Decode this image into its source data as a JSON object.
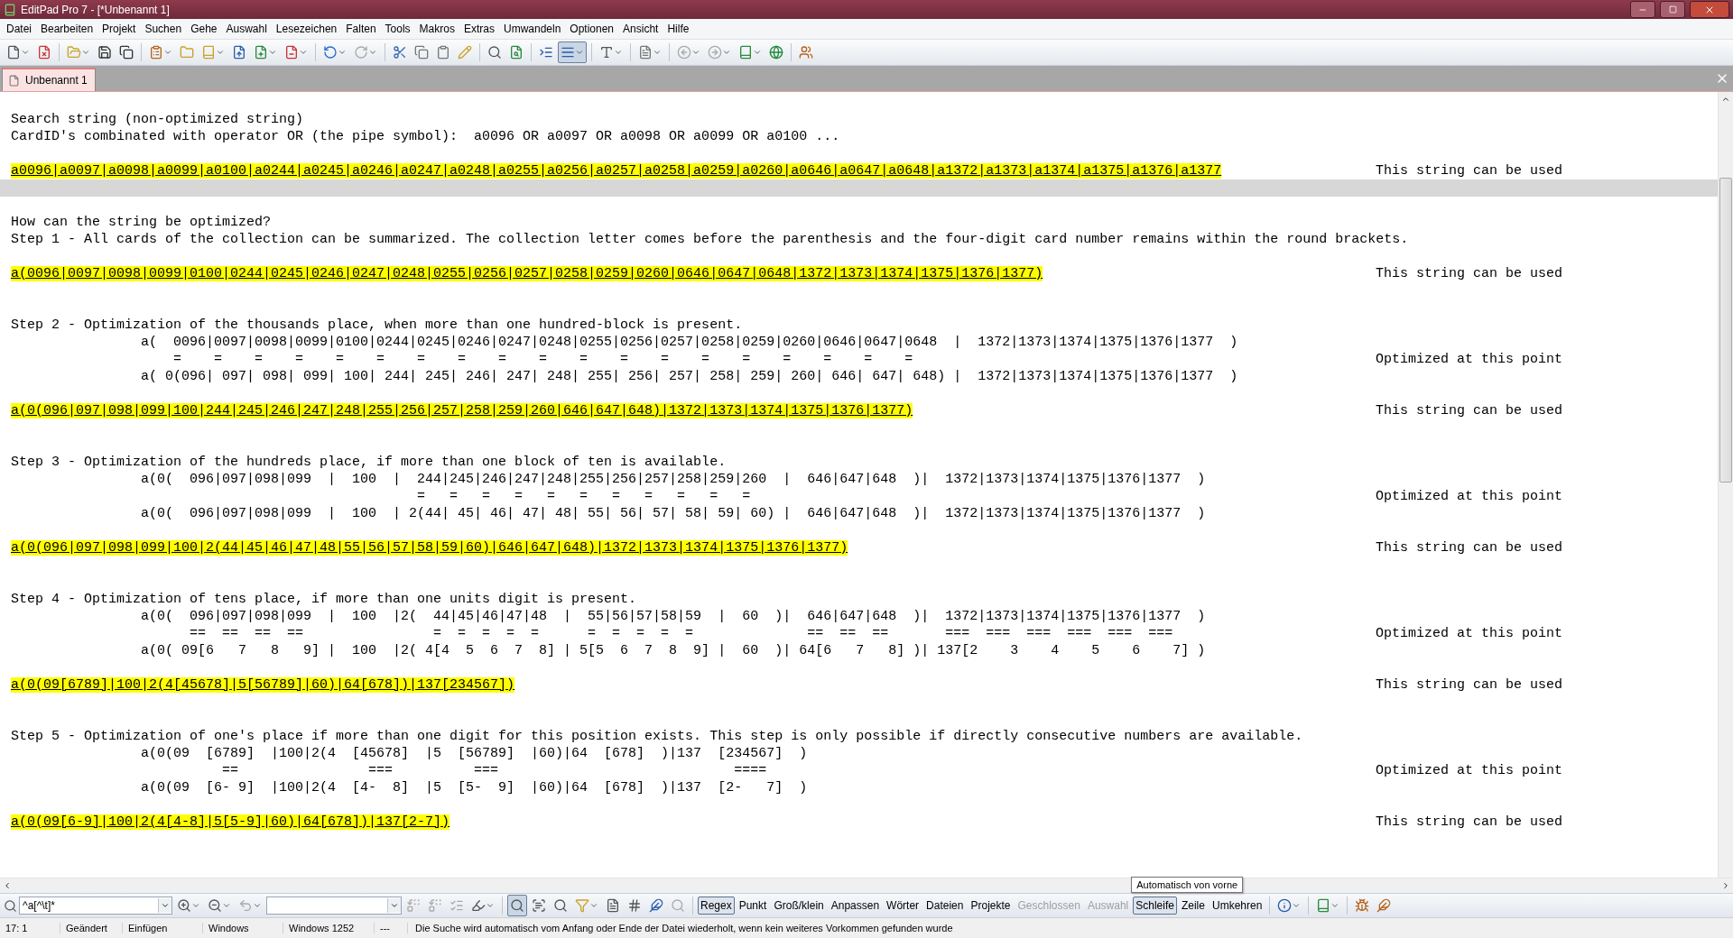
{
  "window": {
    "title": "EditPad Pro 7 - [*Unbenannt 1]"
  },
  "menu": [
    "Datei",
    "Bearbeiten",
    "Projekt",
    "Suchen",
    "Gehe",
    "Auswahl",
    "Lesezeichen",
    "Falten",
    "Tools",
    "Makros",
    "Extras",
    "Umwandeln",
    "Optionen",
    "Ansicht",
    "Hilfe"
  ],
  "tabs": [
    {
      "label": "Unbenannt 1",
      "selected": true
    }
  ],
  "editor": {
    "lines": [
      {
        "kind": "text",
        "current": false,
        "text": "Search string (non-optimized string)"
      },
      {
        "kind": "text",
        "current": false,
        "text": "CardID's combinated with operator OR (the pipe symbol):  a0096 OR a0097 OR a0098 OR a0099 OR a0100 ..."
      },
      {
        "kind": "blank",
        "current": false
      },
      {
        "kind": "match",
        "current": false,
        "text": "a0096|a0097|a0098|a0099|a0100|a0244|a0245|a0246|a0247|a0248|a0255|a0256|a0257|a0258|a0259|a0260|a0646|a0647|a0648|a1372|a1373|a1374|a1375|a1376|a1377",
        "note": "This string can be used"
      },
      {
        "kind": "blank",
        "current": true
      },
      {
        "kind": "blank",
        "current": false
      },
      {
        "kind": "text",
        "current": false,
        "text": "How can the string be optimized?"
      },
      {
        "kind": "text",
        "current": false,
        "text": "Step 1 - All cards of the collection can be summarized. The collection letter comes before the parenthesis and the four-digit card number remains within the round brackets."
      },
      {
        "kind": "blank",
        "current": false
      },
      {
        "kind": "match",
        "current": false,
        "text": "a(0096|0097|0098|0099|0100|0244|0245|0246|0247|0248|0255|0256|0257|0258|0259|0260|0646|0647|0648|1372|1373|1374|1375|1376|1377)",
        "note": "This string can be used"
      },
      {
        "kind": "blank",
        "current": false
      },
      {
        "kind": "blank",
        "current": false
      },
      {
        "kind": "text",
        "current": false,
        "text": "Step 2 - Optimization of the thousands place, when more than one hundred-block is present."
      },
      {
        "kind": "text",
        "current": false,
        "text": "                a(  0096|0097|0098|0099|0100|0244|0245|0246|0247|0248|0255|0256|0257|0258|0259|0260|0646|0647|0648  |  1372|1373|1374|1375|1376|1377  )"
      },
      {
        "kind": "text",
        "current": false,
        "text": "                    =    =    =    =    =    =    =    =    =    =    =    =    =    =    =    =    =    =    =",
        "note": "Optimized at this point"
      },
      {
        "kind": "text",
        "current": false,
        "text": "                a( 0(096| 097| 098| 099| 100| 244| 245| 246| 247| 248| 255| 256| 257| 258| 259| 260| 646| 647| 648) |  1372|1373|1374|1375|1376|1377  )"
      },
      {
        "kind": "blank",
        "current": false
      },
      {
        "kind": "match",
        "current": false,
        "text": "a(0(096|097|098|099|100|244|245|246|247|248|255|256|257|258|259|260|646|647|648)|1372|1373|1374|1375|1376|1377)",
        "note": "This string can be used"
      },
      {
        "kind": "blank",
        "current": false
      },
      {
        "kind": "blank",
        "current": false
      },
      {
        "kind": "text",
        "current": false,
        "text": "Step 3 - Optimization of the hundreds place, if more than one block of ten is available."
      },
      {
        "kind": "text",
        "current": false,
        "text": "                a(0(  096|097|098|099  |  100  |  244|245|246|247|248|255|256|257|258|259|260  |  646|647|648  )|  1372|1373|1374|1375|1376|1377  )"
      },
      {
        "kind": "text",
        "current": false,
        "text": "                                                  =   =   =   =   =   =   =   =   =   =   =",
        "note": "Optimized at this point"
      },
      {
        "kind": "text",
        "current": false,
        "text": "                a(0(  096|097|098|099  |  100  | 2(44| 45| 46| 47| 48| 55| 56| 57| 58| 59| 60) |  646|647|648  )|  1372|1373|1374|1375|1376|1377  )"
      },
      {
        "kind": "blank",
        "current": false
      },
      {
        "kind": "match",
        "current": false,
        "text": "a(0(096|097|098|099|100|2(44|45|46|47|48|55|56|57|58|59|60)|646|647|648)|1372|1373|1374|1375|1376|1377)",
        "note": "This string can be used"
      },
      {
        "kind": "blank",
        "current": false
      },
      {
        "kind": "blank",
        "current": false
      },
      {
        "kind": "text",
        "current": false,
        "text": "Step 4 - Optimization of tens place, if more than one units digit is present."
      },
      {
        "kind": "text",
        "current": false,
        "text": "                a(0(  096|097|098|099  |  100  |2(  44|45|46|47|48  |  55|56|57|58|59  |  60  )|  646|647|648  )|  1372|1373|1374|1375|1376|1377  )"
      },
      {
        "kind": "text",
        "current": false,
        "text": "                      ==  ==  ==  ==                =  =  =  =  =      =  =  =  =  =              ==  ==  ==       ===  ===  ===  ===  ===  ===",
        "note": "Optimized at this point"
      },
      {
        "kind": "text",
        "current": false,
        "text": "                a(0( 09[6   7   8   9] |  100  |2( 4[4  5  6  7  8] | 5[5  6  7  8  9] |  60  )| 64[6   7   8] )| 137[2    3    4    5    6    7] )"
      },
      {
        "kind": "blank",
        "current": false
      },
      {
        "kind": "match",
        "current": false,
        "text": "a(0(09[6789]|100|2(4[45678]|5[56789]|60)|64[678])|137[234567])",
        "note": "This string can be used"
      },
      {
        "kind": "blank",
        "current": false
      },
      {
        "kind": "blank",
        "current": false
      },
      {
        "kind": "text",
        "current": false,
        "text": "Step 5 - Optimization of one's place if more than one digit for this position exists. This step is only possible if directly consecutive numbers are available."
      },
      {
        "kind": "text",
        "current": false,
        "text": "                a(0(09  [6789]  |100|2(4  [45678]  |5  [56789]  |60)|64  [678]  )|137  [234567]  )"
      },
      {
        "kind": "text",
        "current": false,
        "text": "                          ==                ===          ===                             ====",
        "note": "Optimized at this point"
      },
      {
        "kind": "text",
        "current": false,
        "text": "                a(0(09  [6- 9]  |100|2(4  [4-  8]  |5  [5-  9]  |60)|64  [678]  )|137  [2-   7]  )"
      },
      {
        "kind": "blank",
        "current": false
      },
      {
        "kind": "match",
        "current": false,
        "text": "a(0(09[6-9]|100|2(4[4-8]|5[5-9]|60)|64[678])|137[2-7])",
        "note": "This string can be used"
      }
    ]
  },
  "search_bar": {
    "query": "^a[^\\t]*",
    "options": [
      {
        "label": "Regex",
        "pressed": true,
        "disabled": false
      },
      {
        "label": "Punkt",
        "pressed": false,
        "disabled": false
      },
      {
        "label": "Groß/klein",
        "pressed": false,
        "disabled": false
      },
      {
        "label": "Anpassen",
        "pressed": false,
        "disabled": false
      },
      {
        "label": "Wörter",
        "pressed": false,
        "disabled": false
      },
      {
        "label": "Dateien",
        "pressed": false,
        "disabled": false
      },
      {
        "label": "Projekte",
        "pressed": false,
        "disabled": false
      },
      {
        "label": "Geschlossen",
        "pressed": false,
        "disabled": true
      },
      {
        "label": "Auswahl",
        "pressed": false,
        "disabled": true
      },
      {
        "label": "Schleife",
        "pressed": true,
        "disabled": false,
        "tooltip": "Automatisch von vorne"
      },
      {
        "label": "Zeile",
        "pressed": false,
        "disabled": false
      },
      {
        "label": "Umkehren",
        "pressed": false,
        "disabled": false
      }
    ]
  },
  "status_bar": {
    "fields": [
      "17: 1",
      "Geändert",
      "Einfügen",
      "Windows",
      "Windows 1252",
      "---"
    ],
    "message": "Die Suche wird automatisch vom Anfang oder Ende der Datei wiederholt, wenn kein weiteres Vorkommen gefunden wurde"
  }
}
